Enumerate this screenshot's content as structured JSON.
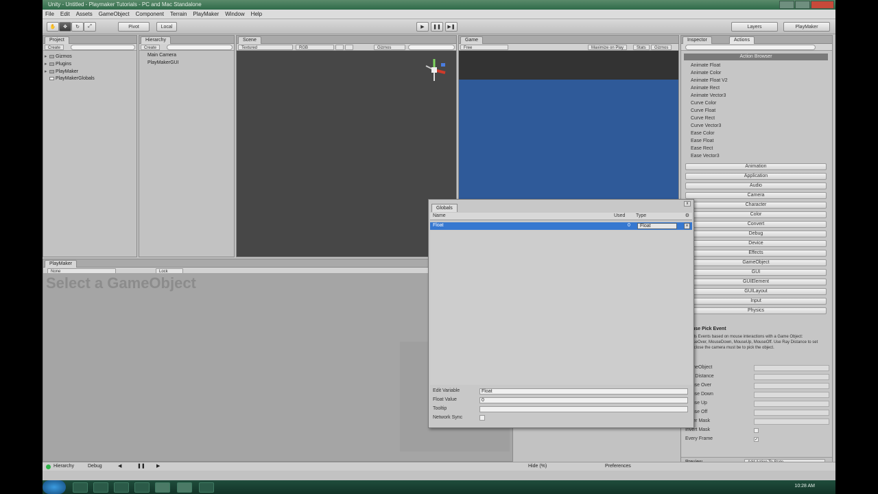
{
  "window": {
    "title": "Unity - Untitled - Playmaker Tutorials - PC and Mac Standalone"
  },
  "menu": [
    "File",
    "Edit",
    "Assets",
    "GameObject",
    "Component",
    "Terrain",
    "PlayMaker",
    "Window",
    "Help"
  ],
  "toolbar": {
    "pivot_label": "Pivot",
    "local_label": "Local",
    "layers_label": "Layers",
    "layout_label": "PlayMaker"
  },
  "project": {
    "tab": "Project",
    "create": "Create",
    "items": [
      "Gizmos",
      "Plugins",
      "PlayMaker",
      "PlayMakerGlobals"
    ]
  },
  "hierarchy": {
    "tab": "Hierarchy",
    "create": "Create",
    "items": [
      "Main Camera",
      "PlayMakerGUI"
    ]
  },
  "scene": {
    "tab": "Scene",
    "shading": "Textured",
    "mode": "RGB",
    "gizmos": "Gizmos"
  },
  "game": {
    "tab": "Game",
    "aspect": "Free",
    "maximize": "Maximize on Play",
    "stats": "Stats",
    "gizmos": "Gizmos"
  },
  "playmaker": {
    "tab": "PlayMaker",
    "hint": "Select a GameObject",
    "fsm_label": "None",
    "lock_label": "Lock"
  },
  "inspector": {
    "tab_inspector": "Inspector",
    "tab_actions": "Actions",
    "header": "Action Browser",
    "list": [
      "Animate Float",
      "Animate Color",
      "Animate Float V2",
      "Animate Rect",
      "Animate Vector3",
      "Curve Color",
      "Curve Float",
      "Curve Rect",
      "Curve Vector3",
      "Ease Color",
      "Ease Float",
      "Ease Rect",
      "Ease Vector3"
    ],
    "categories": [
      "Animation",
      "Application",
      "Audio",
      "Camera",
      "Character",
      "Color",
      "Convert",
      "Debug",
      "Device",
      "Effects",
      "GameObject",
      "GUI",
      "GUIElement",
      "GUILayout",
      "Input",
      "Physics"
    ],
    "desc_title": "Mouse Pick Event",
    "desc_text": "Sends Events based on mouse interactions with a Game Object: MouseOver, MouseDown, MouseUp, MouseOff. Use Ray Distance to set how close the camera must be to pick the object.",
    "preview_label": "Preview",
    "add_label": "Add Action To State",
    "prop_labels": [
      "GameObject",
      "Ray Distance",
      "Mouse Over",
      "Mouse Down",
      "Mouse Up",
      "Mouse Off",
      "Layer Mask",
      "Invert Mask",
      "Every Frame"
    ]
  },
  "globals": {
    "tab": "Globals",
    "col_name": "Name",
    "col_used": "Used",
    "col_type": "Type",
    "row_name": "Float",
    "row_used": "0",
    "row_type": "Float",
    "edit_variable_label": "Edit Variable",
    "edit_variable_value": "Float",
    "float_value_label": "Float Value",
    "float_value": "0",
    "tooltip_label": "Tooltip",
    "network_sync_label": "Network Sync"
  },
  "status": {
    "hierarchy_label": "Hierarchy",
    "debug_label": "Debug",
    "preferences_label": "Preferences",
    "hide_label": "Hide (%)"
  },
  "taskbar": {
    "clock": "10:28 AM"
  }
}
